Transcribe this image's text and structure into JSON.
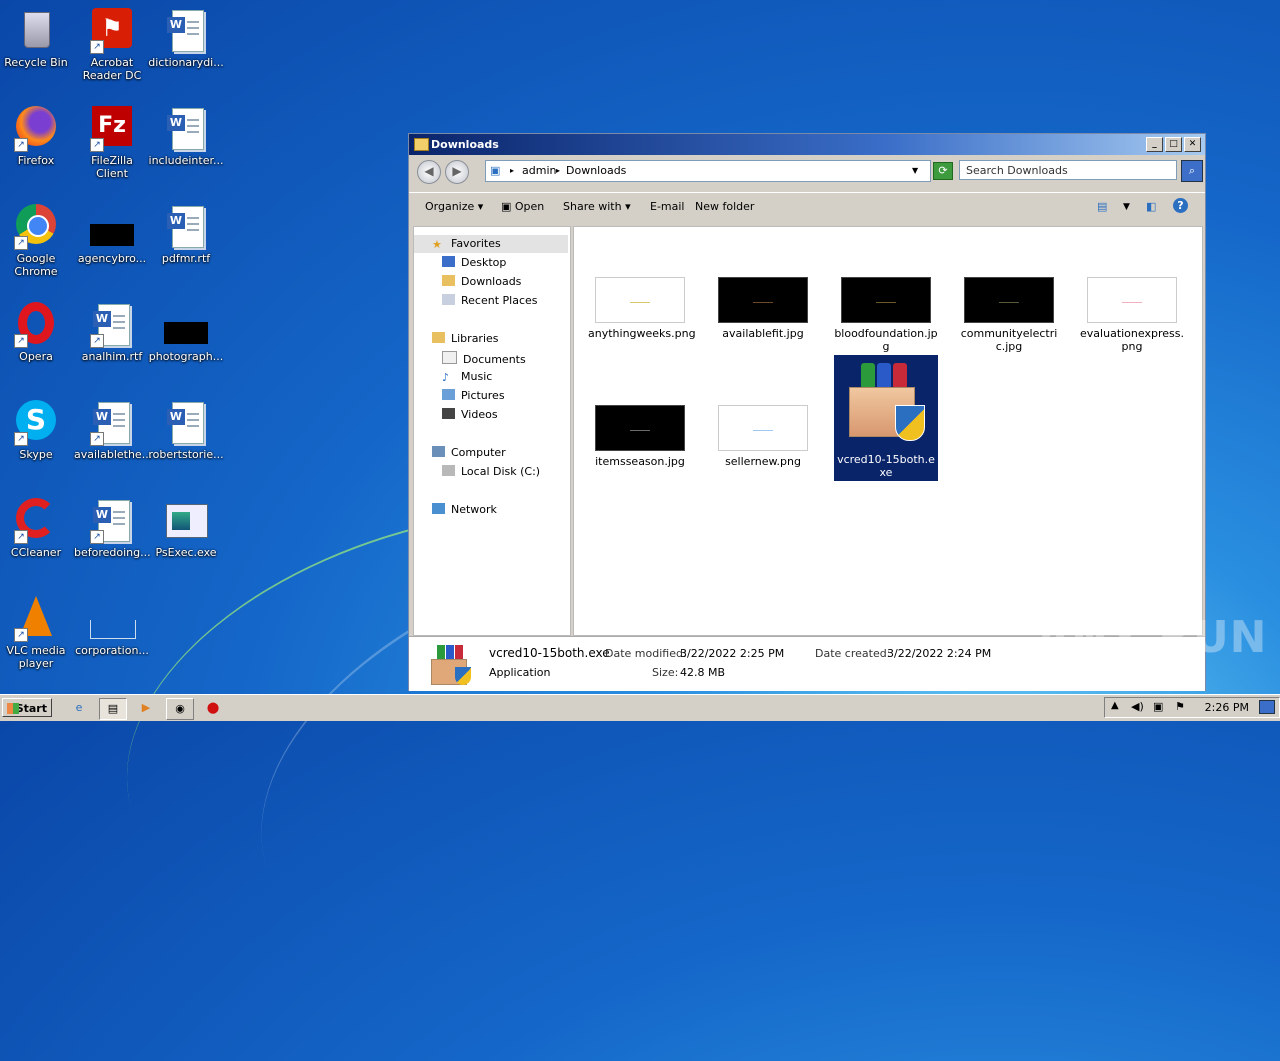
{
  "desktop": {
    "icons": [
      {
        "label": "Recycle Bin",
        "icon": "recycle-bin-icon"
      },
      {
        "label": "Acrobat Reader DC",
        "icon": "acrobat-icon"
      },
      {
        "label": "dictionarydi...",
        "icon": "word-doc-icon"
      },
      {
        "label": "Firefox",
        "icon": "firefox-icon"
      },
      {
        "label": "FileZilla Client",
        "icon": "filezilla-icon"
      },
      {
        "label": "includeinter...",
        "icon": "word-doc-icon"
      },
      {
        "label": "Google Chrome",
        "icon": "chrome-icon"
      },
      {
        "label": "agencybro...",
        "icon": "image-file-icon"
      },
      {
        "label": "pdfmr.rtf",
        "icon": "word-doc-icon"
      },
      {
        "label": "Opera",
        "icon": "opera-icon"
      },
      {
        "label": "analhim.rtf",
        "icon": "word-doc-icon"
      },
      {
        "label": "photograph...",
        "icon": "image-file-icon"
      },
      {
        "label": "Skype",
        "icon": "skype-icon"
      },
      {
        "label": "availablethe...",
        "icon": "word-doc-icon"
      },
      {
        "label": "robertstorie...",
        "icon": "word-doc-icon"
      },
      {
        "label": "CCleaner",
        "icon": "ccleaner-icon"
      },
      {
        "label": "beforedoing...",
        "icon": "word-doc-icon"
      },
      {
        "label": "PsExec.exe",
        "icon": "exe-icon"
      },
      {
        "label": "VLC media player",
        "icon": "vlc-icon"
      },
      {
        "label": "corporation...",
        "icon": "image-file-icon"
      }
    ]
  },
  "window": {
    "title": "Downloads",
    "breadcrumb": [
      "admin",
      "Downloads"
    ],
    "search_placeholder": "Search Downloads",
    "toolbar": {
      "organize": "Organize",
      "open": "Open",
      "share_with": "Share with",
      "email": "E-mail",
      "new_folder": "New folder"
    },
    "nav": {
      "favorites": "Favorites",
      "desktop": "Desktop",
      "downloads": "Downloads",
      "recent_places": "Recent Places",
      "libraries": "Libraries",
      "documents": "Documents",
      "music": "Music",
      "pictures": "Pictures",
      "videos": "Videos",
      "computer": "Computer",
      "local_disk": "Local Disk (C:)",
      "network": "Network"
    },
    "files": [
      {
        "name": "anythingweeks.png",
        "thumb": "white",
        "mark": "#d8c870"
      },
      {
        "name": "availablefit.jpg",
        "thumb": "black",
        "mark": "#6a4a2a"
      },
      {
        "name": "bloodfoundation.jpg",
        "thumb": "black",
        "mark": "#6a5a2a"
      },
      {
        "name": "communityelectric.jpg",
        "thumb": "black",
        "mark": "#5a5a3a"
      },
      {
        "name": "evaluationexpress.png",
        "thumb": "white",
        "mark": "#f0b0c0"
      },
      {
        "name": "itemsseason.jpg",
        "thumb": "black",
        "mark": "#6a6a6a"
      },
      {
        "name": "sellernew.png",
        "thumb": "white",
        "mark": "#a0c8f0"
      },
      {
        "name": "vcred10-15both.exe",
        "thumb": "package",
        "selected": true
      }
    ],
    "details": {
      "name": "vcred10-15both.exe",
      "type": "Application",
      "modified_label": "Date modified:",
      "modified": "3/22/2022 2:25 PM",
      "size_label": "Size:",
      "size": "42.8 MB",
      "created_label": "Date created:",
      "created": "3/22/2022 2:24 PM"
    }
  },
  "taskbar": {
    "start": "Start",
    "clock": "2:26 PM"
  },
  "watermark": "ANY RUN"
}
